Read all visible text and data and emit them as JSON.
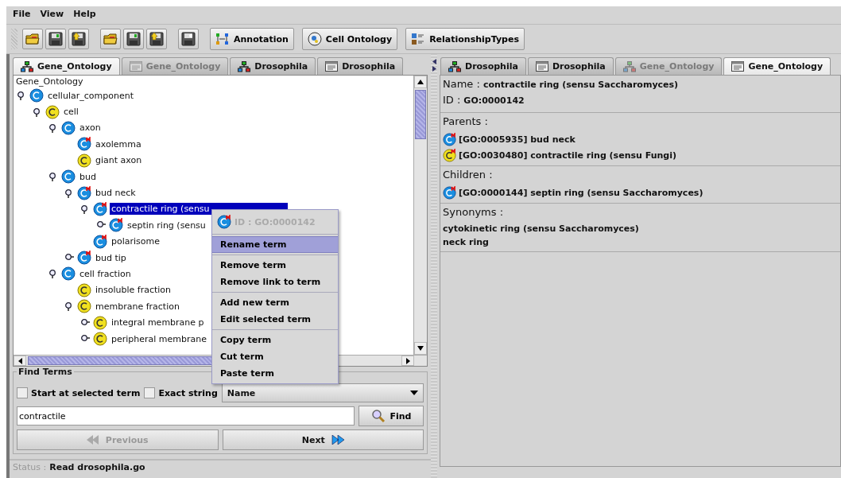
{
  "menu": [
    "File",
    "View",
    "Help"
  ],
  "toolbar": {
    "buttons": [
      {
        "label": "Annotation",
        "kind": "annotation"
      },
      {
        "label": "Cell Ontology",
        "kind": "cell"
      },
      {
        "label": "RelationshipTypes",
        "kind": "types"
      }
    ]
  },
  "left_tabs": [
    {
      "label": "Gene_Ontology",
      "kind": "tree",
      "selected": true,
      "disabled": false
    },
    {
      "label": "Gene_Ontology",
      "kind": "panel",
      "selected": false,
      "disabled": true
    },
    {
      "label": "Drosophila",
      "kind": "tree",
      "selected": false,
      "disabled": false
    },
    {
      "label": "Drosophila",
      "kind": "panel",
      "selected": false,
      "disabled": false
    }
  ],
  "tree": {
    "root": "Gene_Ontology",
    "items": [
      {
        "label": "cellular_component",
        "kind": "blue",
        "flagged": false,
        "expanded": true,
        "selected": false,
        "children": [
          {
            "label": "cell",
            "kind": "yellow",
            "flagged": false,
            "expanded": true,
            "selected": false,
            "children": [
              {
                "label": "axon",
                "kind": "blue",
                "flagged": false,
                "expanded": true,
                "selected": false,
                "children": [
                  {
                    "label": "axolemma",
                    "kind": "blue",
                    "flagged": true,
                    "selected": false
                  },
                  {
                    "label": "giant axon",
                    "kind": "yellow",
                    "flagged": false,
                    "selected": false
                  }
                ]
              },
              {
                "label": "bud",
                "kind": "blue",
                "flagged": false,
                "expanded": true,
                "selected": false,
                "children": [
                  {
                    "label": "bud neck",
                    "kind": "blue",
                    "flagged": true,
                    "expanded": true,
                    "selected": false,
                    "children": [
                      {
                        "label": "contractile ring (sensu",
                        "kind": "blue",
                        "flagged": true,
                        "expanded": true,
                        "selected": true,
                        "children": [
                          {
                            "label": "septin ring (sensu",
                            "kind": "blue",
                            "flagged": true,
                            "expanded": false,
                            "selected": false
                          }
                        ]
                      },
                      {
                        "label": "polarisome",
                        "kind": "blue",
                        "flagged": true,
                        "selected": false
                      }
                    ]
                  },
                  {
                    "label": "bud tip",
                    "kind": "blue",
                    "flagged": true,
                    "expanded": false,
                    "selected": false
                  }
                ]
              },
              {
                "label": "cell fraction",
                "kind": "blue",
                "flagged": false,
                "expanded": true,
                "selected": false,
                "children": [
                  {
                    "label": "insoluble fraction",
                    "kind": "yellow",
                    "flagged": false,
                    "selected": false
                  },
                  {
                    "label": "membrane fraction",
                    "kind": "yellow",
                    "flagged": false,
                    "expanded": true,
                    "selected": false,
                    "children": [
                      {
                        "label": "integral membrane p",
                        "kind": "yellow",
                        "flagged": false,
                        "expanded": false,
                        "selected": false
                      },
                      {
                        "label": "peripheral membrane",
                        "kind": "yellow",
                        "flagged": false,
                        "expanded": false,
                        "selected": false
                      }
                    ]
                  }
                ]
              }
            ]
          }
        ]
      }
    ]
  },
  "context_menu": {
    "header": "ID : GO:0000142",
    "groups": [
      [
        {
          "label": "Rename term",
          "selected": true
        }
      ],
      [
        {
          "label": "Remove term",
          "selected": false
        },
        {
          "label": "Remove link to term",
          "selected": false
        }
      ],
      [
        {
          "label": "Add new term",
          "selected": false
        },
        {
          "label": "Edit selected term",
          "selected": false
        }
      ],
      [
        {
          "label": "Copy term",
          "selected": false
        },
        {
          "label": "Cut term",
          "selected": false
        },
        {
          "label": "Paste term",
          "selected": false
        }
      ]
    ]
  },
  "find": {
    "title": "Find Terms",
    "options": [
      {
        "label": "Start at selected term",
        "checked": false
      },
      {
        "label": "Exact string",
        "checked": false
      }
    ],
    "field_select": "Name",
    "query": "contractile",
    "find_button": "Find",
    "previous": {
      "label": "Previous",
      "disabled": true
    },
    "next": {
      "label": "Next",
      "disabled": false
    }
  },
  "status": {
    "label": "Status :",
    "text": "Read drosophila.go"
  },
  "right_tabs": [
    {
      "label": "Drosophila",
      "kind": "tree",
      "selected": false,
      "disabled": false
    },
    {
      "label": "Drosophila",
      "kind": "panel",
      "selected": false,
      "disabled": false
    },
    {
      "label": "Gene_Ontology",
      "kind": "tree",
      "selected": false,
      "disabled": true
    },
    {
      "label": "Gene_Ontology",
      "kind": "panel",
      "selected": true,
      "disabled": false
    }
  ],
  "details": {
    "name_label": "Name :",
    "name": "contractile ring (sensu Saccharomyces)",
    "id_label": "ID :",
    "id": "GO:0000142",
    "sections": [
      {
        "title": "Parents :",
        "entries": [
          {
            "text": "[GO:0005935] bud neck",
            "kind": "blue"
          },
          {
            "text": "[GO:0030480] contractile ring (sensu Fungi)",
            "kind": "yellow"
          }
        ]
      },
      {
        "title": "Children :",
        "entries": [
          {
            "text": "[GO:0000144] septin ring (sensu Saccharomyces)",
            "kind": "blue"
          }
        ]
      },
      {
        "title": "Synonyms :",
        "entries": [
          {
            "text": "cytokinetic ring (sensu Saccharomyces)",
            "kind": "plain"
          },
          {
            "text": "neck ring",
            "kind": "plain"
          }
        ]
      }
    ]
  }
}
